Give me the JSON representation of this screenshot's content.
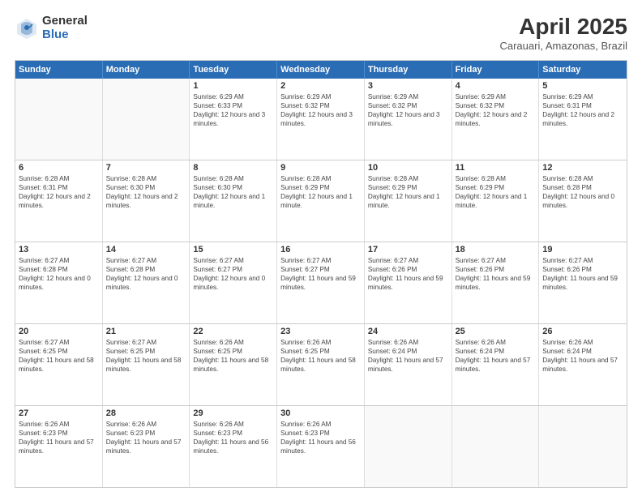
{
  "logo": {
    "general": "General",
    "blue": "Blue"
  },
  "title": "April 2025",
  "subtitle": "Carauari, Amazonas, Brazil",
  "header_days": [
    "Sunday",
    "Monday",
    "Tuesday",
    "Wednesday",
    "Thursday",
    "Friday",
    "Saturday"
  ],
  "weeks": [
    [
      {
        "day": "",
        "info": ""
      },
      {
        "day": "",
        "info": ""
      },
      {
        "day": "1",
        "info": "Sunrise: 6:29 AM\nSunset: 6:33 PM\nDaylight: 12 hours and 3 minutes."
      },
      {
        "day": "2",
        "info": "Sunrise: 6:29 AM\nSunset: 6:32 PM\nDaylight: 12 hours and 3 minutes."
      },
      {
        "day": "3",
        "info": "Sunrise: 6:29 AM\nSunset: 6:32 PM\nDaylight: 12 hours and 3 minutes."
      },
      {
        "day": "4",
        "info": "Sunrise: 6:29 AM\nSunset: 6:32 PM\nDaylight: 12 hours and 2 minutes."
      },
      {
        "day": "5",
        "info": "Sunrise: 6:29 AM\nSunset: 6:31 PM\nDaylight: 12 hours and 2 minutes."
      }
    ],
    [
      {
        "day": "6",
        "info": "Sunrise: 6:28 AM\nSunset: 6:31 PM\nDaylight: 12 hours and 2 minutes."
      },
      {
        "day": "7",
        "info": "Sunrise: 6:28 AM\nSunset: 6:30 PM\nDaylight: 12 hours and 2 minutes."
      },
      {
        "day": "8",
        "info": "Sunrise: 6:28 AM\nSunset: 6:30 PM\nDaylight: 12 hours and 1 minute."
      },
      {
        "day": "9",
        "info": "Sunrise: 6:28 AM\nSunset: 6:29 PM\nDaylight: 12 hours and 1 minute."
      },
      {
        "day": "10",
        "info": "Sunrise: 6:28 AM\nSunset: 6:29 PM\nDaylight: 12 hours and 1 minute."
      },
      {
        "day": "11",
        "info": "Sunrise: 6:28 AM\nSunset: 6:29 PM\nDaylight: 12 hours and 1 minute."
      },
      {
        "day": "12",
        "info": "Sunrise: 6:28 AM\nSunset: 6:28 PM\nDaylight: 12 hours and 0 minutes."
      }
    ],
    [
      {
        "day": "13",
        "info": "Sunrise: 6:27 AM\nSunset: 6:28 PM\nDaylight: 12 hours and 0 minutes."
      },
      {
        "day": "14",
        "info": "Sunrise: 6:27 AM\nSunset: 6:28 PM\nDaylight: 12 hours and 0 minutes."
      },
      {
        "day": "15",
        "info": "Sunrise: 6:27 AM\nSunset: 6:27 PM\nDaylight: 12 hours and 0 minutes."
      },
      {
        "day": "16",
        "info": "Sunrise: 6:27 AM\nSunset: 6:27 PM\nDaylight: 11 hours and 59 minutes."
      },
      {
        "day": "17",
        "info": "Sunrise: 6:27 AM\nSunset: 6:26 PM\nDaylight: 11 hours and 59 minutes."
      },
      {
        "day": "18",
        "info": "Sunrise: 6:27 AM\nSunset: 6:26 PM\nDaylight: 11 hours and 59 minutes."
      },
      {
        "day": "19",
        "info": "Sunrise: 6:27 AM\nSunset: 6:26 PM\nDaylight: 11 hours and 59 minutes."
      }
    ],
    [
      {
        "day": "20",
        "info": "Sunrise: 6:27 AM\nSunset: 6:25 PM\nDaylight: 11 hours and 58 minutes."
      },
      {
        "day": "21",
        "info": "Sunrise: 6:27 AM\nSunset: 6:25 PM\nDaylight: 11 hours and 58 minutes."
      },
      {
        "day": "22",
        "info": "Sunrise: 6:26 AM\nSunset: 6:25 PM\nDaylight: 11 hours and 58 minutes."
      },
      {
        "day": "23",
        "info": "Sunrise: 6:26 AM\nSunset: 6:25 PM\nDaylight: 11 hours and 58 minutes."
      },
      {
        "day": "24",
        "info": "Sunrise: 6:26 AM\nSunset: 6:24 PM\nDaylight: 11 hours and 57 minutes."
      },
      {
        "day": "25",
        "info": "Sunrise: 6:26 AM\nSunset: 6:24 PM\nDaylight: 11 hours and 57 minutes."
      },
      {
        "day": "26",
        "info": "Sunrise: 6:26 AM\nSunset: 6:24 PM\nDaylight: 11 hours and 57 minutes."
      }
    ],
    [
      {
        "day": "27",
        "info": "Sunrise: 6:26 AM\nSunset: 6:23 PM\nDaylight: 11 hours and 57 minutes."
      },
      {
        "day": "28",
        "info": "Sunrise: 6:26 AM\nSunset: 6:23 PM\nDaylight: 11 hours and 57 minutes."
      },
      {
        "day": "29",
        "info": "Sunrise: 6:26 AM\nSunset: 6:23 PM\nDaylight: 11 hours and 56 minutes."
      },
      {
        "day": "30",
        "info": "Sunrise: 6:26 AM\nSunset: 6:23 PM\nDaylight: 11 hours and 56 minutes."
      },
      {
        "day": "",
        "info": ""
      },
      {
        "day": "",
        "info": ""
      },
      {
        "day": "",
        "info": ""
      }
    ]
  ]
}
